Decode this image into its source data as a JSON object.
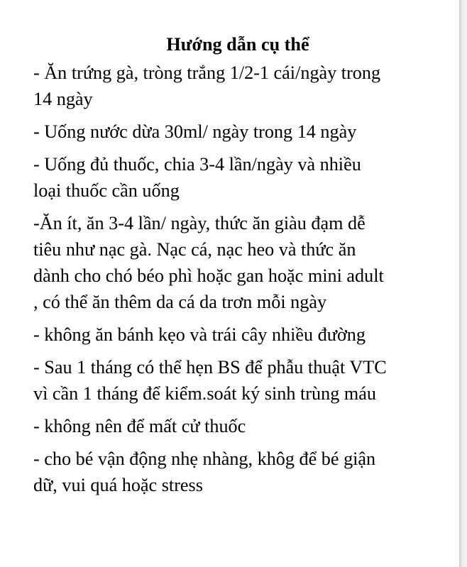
{
  "document": {
    "title": "Hướng dẫn cụ thể",
    "paragraphs": [
      {
        "lines": [
          "- Ăn trứng gà, tròng trắng 1/2-1 cái/ngày trong",
          "14 ngày"
        ]
      },
      {
        "lines": [
          "- Uống nước dừa 30ml/ ngày trong 14 ngày"
        ]
      },
      {
        "lines": [
          "- Uống đủ thuốc, chia 3-4 lần/ngày và nhiều",
          "loại thuốc cần uống"
        ]
      },
      {
        "lines": [
          "-Ăn ít, ăn 3-4 lần/ ngày, thức ăn giàu đạm dễ",
          "tiêu như nạc gà. Nạc cá, nạc heo và thức ăn",
          "dành cho chó béo phì hoặc gan hoặc mini adult",
          ", có thể ăn thêm da cá da trơn mỗi ngày"
        ]
      },
      {
        "lines": [
          "- không ăn bánh kẹo và trái cây nhiều đường"
        ]
      },
      {
        "lines": [
          "- Sau 1 tháng có thể hẹn BS để phẫu thuật VTC",
          "vì cần 1 tháng để kiểm.soát ký sinh trùng máu"
        ]
      },
      {
        "lines": [
          "- không nên để mất cử thuốc"
        ]
      },
      {
        "lines": [
          "- cho bé vận động nhẹ nhàng, khôg để bé giận",
          "dữ, vui quá hoặc stress"
        ]
      }
    ]
  }
}
